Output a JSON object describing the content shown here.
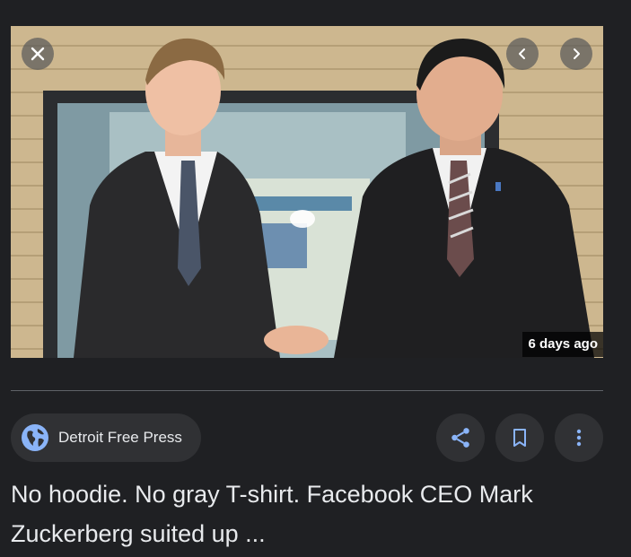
{
  "image": {
    "timestamp": "6 days ago"
  },
  "controls": {
    "close_icon": "close-icon",
    "prev_icon": "chevron-left-icon",
    "next_icon": "chevron-right-icon"
  },
  "source": {
    "name": "Detroit Free Press",
    "icon": "globe-icon"
  },
  "actions": {
    "share_icon": "share-icon",
    "save_icon": "bookmark-icon",
    "more_icon": "more-vert-icon"
  },
  "headline": "No hoodie. No gray T-shirt. Facebook CEO Mark Zuckerberg suited up ...",
  "colors": {
    "background": "#1f2023",
    "chip": "#303134",
    "accent": "#8ab4f8",
    "text": "#e8eaed"
  }
}
